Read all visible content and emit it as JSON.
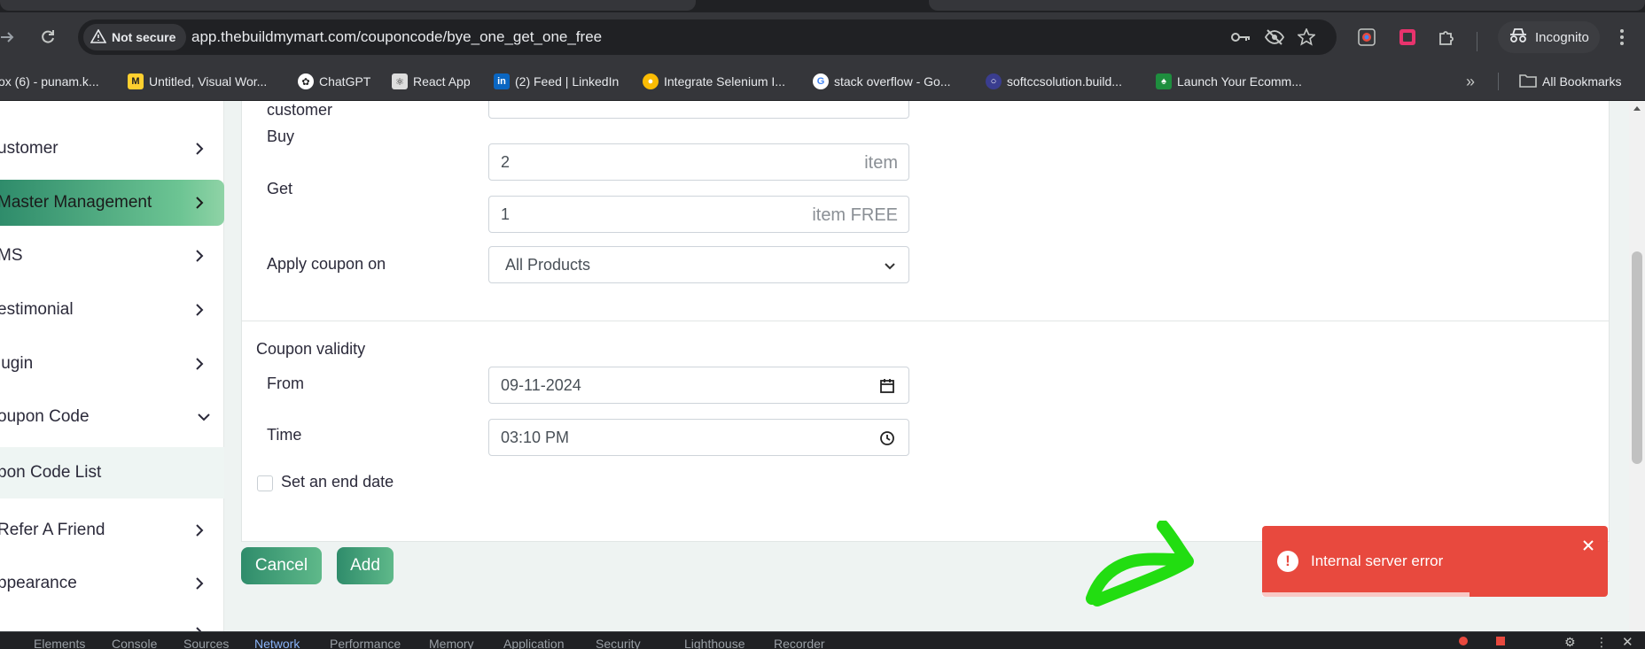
{
  "browser": {
    "security_label": "Not secure",
    "url": "app.thebuildmymart.com/couponcode/bye_one_get_one_free",
    "incognito_label": "Incognito",
    "bookmarks": [
      {
        "label": "ox (6) - punam.k...",
        "favicon": "mail-icon",
        "color": "#ea4335"
      },
      {
        "label": "Untitled, Visual Wor...",
        "favicon": "miro-icon",
        "color": "#ffd02f"
      },
      {
        "label": "ChatGPT",
        "favicon": "chatgpt-icon",
        "color": "#ffffff"
      },
      {
        "label": "React App",
        "favicon": "react-icon",
        "color": "#dddddd"
      },
      {
        "label": "(2) Feed | LinkedIn",
        "favicon": "linkedin-icon",
        "color": "#0a66c2"
      },
      {
        "label": "Integrate Selenium I...",
        "favicon": "chrome-icon",
        "color": "#fbbc04"
      },
      {
        "label": "stack overflow - Go...",
        "favicon": "google-icon",
        "color": "#4285f4"
      },
      {
        "label": "softccsolution.build...",
        "favicon": "globe-icon",
        "color": "#3a3d8f"
      },
      {
        "label": "Launch Your Ecomm...",
        "favicon": "store-icon",
        "color": "#1e8e3e"
      }
    ],
    "all_bookmarks_label": "All Bookmarks"
  },
  "sidebar": {
    "items": [
      {
        "label": "ustomer",
        "expanded": false
      },
      {
        "label": "Master Management",
        "expanded": false,
        "active": true
      },
      {
        "label": "MS",
        "expanded": false
      },
      {
        "label": "estimonial",
        "expanded": false
      },
      {
        "label": "lugin",
        "expanded": false
      },
      {
        "label": "oupon Code",
        "expanded": true
      },
      {
        "label": "pon Code List",
        "sub": true
      },
      {
        "label": "Refer A Friend",
        "expanded": false
      },
      {
        "label": "ppearance",
        "expanded": false
      }
    ]
  },
  "form": {
    "customer_label": "customer",
    "buy_label": "Buy",
    "buy_value": "2",
    "buy_suffix": "item",
    "get_label": "Get",
    "get_value": "1",
    "get_suffix": "item FREE",
    "apply_label": "Apply coupon on",
    "apply_value": "All Products",
    "validity_title": "Coupon validity",
    "from_label": "From",
    "from_value": "09-11-2024",
    "time_label": "Time",
    "time_value": "03:10  PM",
    "end_date_label": "Set an end date"
  },
  "actions": {
    "cancel_label": "Cancel",
    "add_label": "Add"
  },
  "toast": {
    "message": "Internal server error",
    "progress": 0.6,
    "color": "#e8493e"
  },
  "devtools": {
    "tabs": [
      "Elements",
      "Console",
      "Sources",
      "Network",
      "Performance",
      "Memory",
      "Application",
      "Security",
      "Lighthouse",
      "Recorder"
    ],
    "active_tab": "Network"
  },
  "colors": {
    "accent": "#2f8c6b",
    "annotation": "#22dd11"
  }
}
